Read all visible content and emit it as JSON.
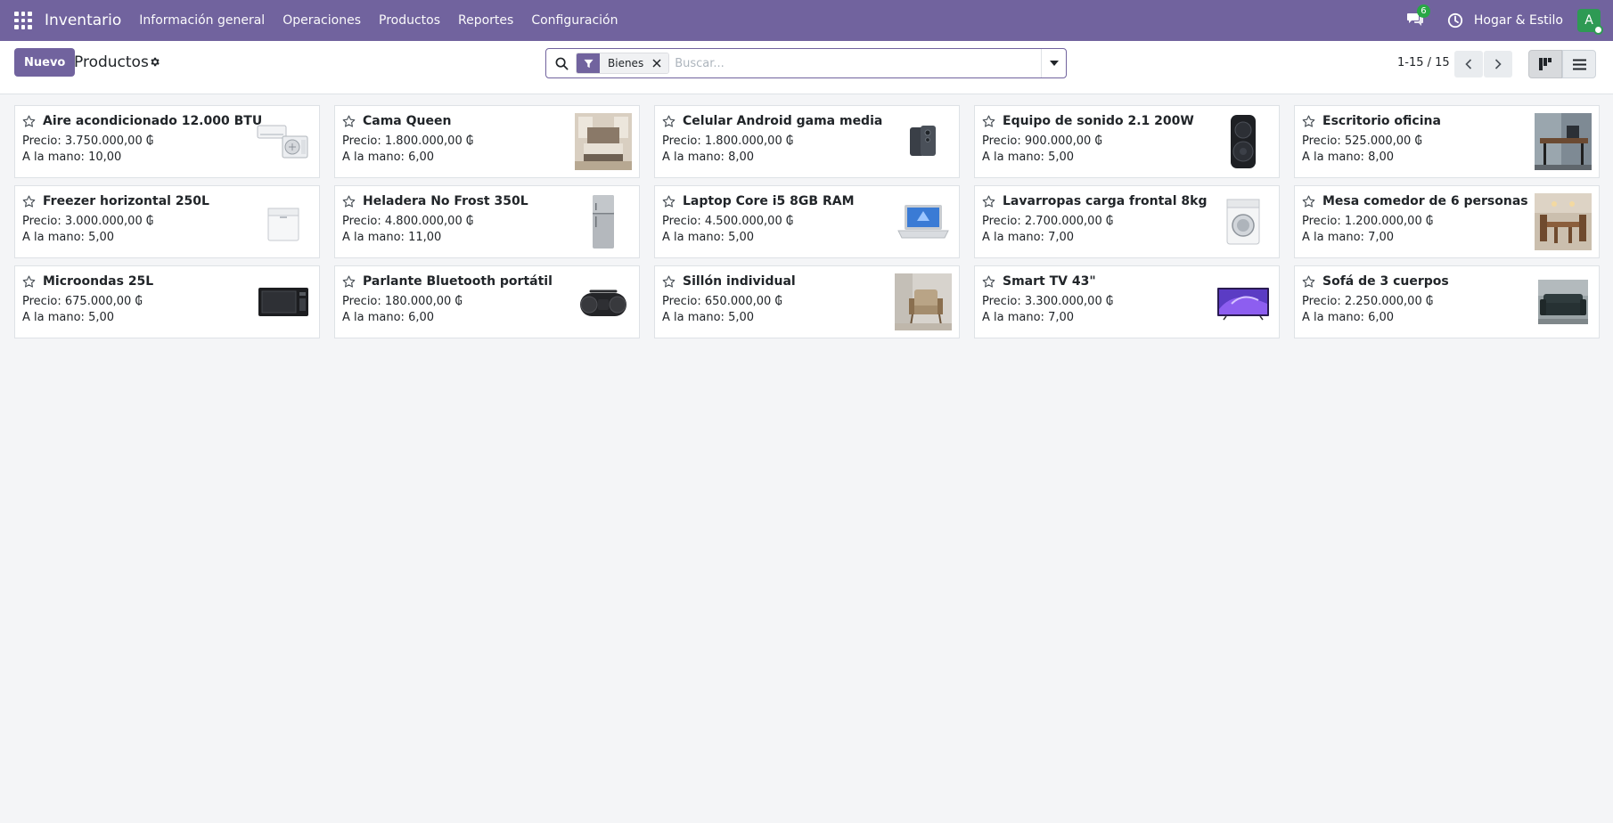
{
  "navbar": {
    "app_name": "Inventario",
    "menu": [
      {
        "label": "Información general"
      },
      {
        "label": "Operaciones"
      },
      {
        "label": "Productos"
      },
      {
        "label": "Reportes"
      },
      {
        "label": "Configuración"
      }
    ],
    "messages_count": "6",
    "company": "Hogar & Estilo",
    "avatar_letter": "A",
    "colors": {
      "bar": "#71639e",
      "avatar": "#2e9a54",
      "badge": "#28a745"
    }
  },
  "control_panel": {
    "new_label": "Nuevo",
    "title": "Productos",
    "search": {
      "facet_label": "Bienes",
      "placeholder": "Buscar..."
    },
    "pager": "1-15 / 15"
  },
  "products": [
    {
      "name": "Aire acondicionado 12.000 BTU",
      "price": "Precio: 3.750.000,00 ₲",
      "on_hand": "A la mano: 10,00",
      "image_icon": "air-conditioner-icon"
    },
    {
      "name": "Cama Queen",
      "price": "Precio: 1.800.000,00 ₲",
      "on_hand": "A la mano: 6,00",
      "image_icon": "bed-icon"
    },
    {
      "name": "Celular Android gama media",
      "price": "Precio: 1.800.000,00 ₲",
      "on_hand": "A la mano: 8,00",
      "image_icon": "smartphone-icon"
    },
    {
      "name": "Equipo de sonido 2.1 200W",
      "price": "Precio: 900.000,00 ₲",
      "on_hand": "A la mano: 5,00",
      "image_icon": "speaker-tower-icon"
    },
    {
      "name": "Escritorio oficina",
      "price": "Precio: 525.000,00 ₲",
      "on_hand": "A la mano: 8,00",
      "image_icon": "desk-icon"
    },
    {
      "name": "Freezer horizontal 250L",
      "price": "Precio: 3.000.000,00 ₲",
      "on_hand": "A la mano: 5,00",
      "image_icon": "chest-freezer-icon"
    },
    {
      "name": "Heladera No Frost 350L",
      "price": "Precio: 4.800.000,00 ₲",
      "on_hand": "A la mano: 11,00",
      "image_icon": "fridge-icon"
    },
    {
      "name": "Laptop Core i5 8GB RAM",
      "price": "Precio: 4.500.000,00 ₲",
      "on_hand": "A la mano: 5,00",
      "image_icon": "laptop-icon"
    },
    {
      "name": "Lavarropas carga frontal 8kg",
      "price": "Precio: 2.700.000,00 ₲",
      "on_hand": "A la mano: 7,00",
      "image_icon": "washing-machine-icon"
    },
    {
      "name": "Mesa comedor de 6 personas",
      "price": "Precio: 1.200.000,00 ₲",
      "on_hand": "A la mano: 7,00",
      "image_icon": "dining-table-icon"
    },
    {
      "name": "Microondas 25L",
      "price": "Precio: 675.000,00 ₲",
      "on_hand": "A la mano: 5,00",
      "image_icon": "microwave-icon"
    },
    {
      "name": "Parlante Bluetooth portátil",
      "price": "Precio: 180.000,00 ₲",
      "on_hand": "A la mano: 6,00",
      "image_icon": "bluetooth-speaker-icon"
    },
    {
      "name": "Sillón individual",
      "price": "Precio: 650.000,00 ₲",
      "on_hand": "A la mano: 5,00",
      "image_icon": "armchair-icon"
    },
    {
      "name": "Smart TV 43\"",
      "price": "Precio: 3.300.000,00 ₲",
      "on_hand": "A la mano: 7,00",
      "image_icon": "tv-icon"
    },
    {
      "name": "Sofá de 3 cuerpos",
      "price": "Precio: 2.250.000,00 ₲",
      "on_hand": "A la mano: 6,00",
      "image_icon": "sofa-icon"
    }
  ]
}
